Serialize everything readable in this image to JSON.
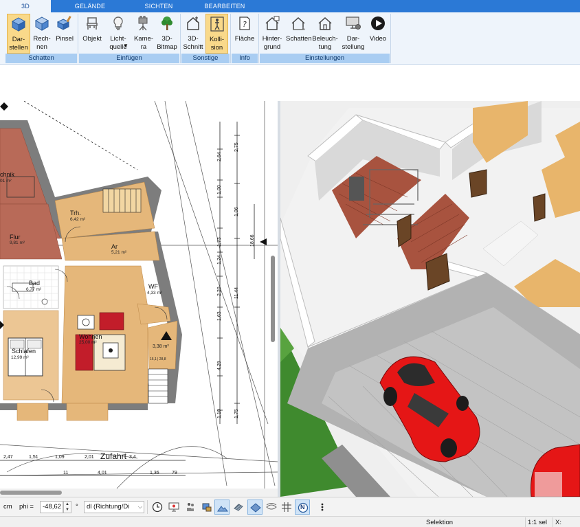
{
  "tabs": [
    {
      "label": "3D",
      "active": true
    },
    {
      "label": "GELÄNDE",
      "active": false
    },
    {
      "label": "SICHTEN",
      "active": false
    },
    {
      "label": "BEARBEITEN",
      "active": false
    }
  ],
  "ribbon": {
    "buttons": {
      "darstellen": "Dar-\nstellen",
      "rechnen": "Rech-\nnen",
      "pinsel": "Pinsel",
      "objekt": "Objekt",
      "lichtquelle": "Licht-\nquelle",
      "kamera": "Kame-\nra",
      "bitmap3d": "3D-\nBitmap",
      "schnitt3d": "3D-\nSchnitt",
      "kollision": "Kolli-\nsion",
      "flaeche": "Fläche",
      "hintergrund": "Hinter-\ngrund",
      "schatten_btn": "Schatten",
      "beleuchtung": "Beleuch-\ntung",
      "darstellung": "Dar-\nstellung",
      "video": "Video"
    },
    "groups": {
      "schatten": "Schatten",
      "einfuegen": "Einfügen",
      "sonstige": "Sonstige",
      "info": "Info",
      "einstellungen": "Einstellungen"
    },
    "accent": "#2b79d6",
    "active_button_color": "#f9d98a"
  },
  "plan": {
    "rooms": {
      "technik": {
        "name": "chnik",
        "area": "01 m²"
      },
      "flur": {
        "name": "Flur",
        "area": "9,81 m²"
      },
      "treppe": {
        "name": "Trh.",
        "area": "6,42 m²"
      },
      "ar": {
        "name": "Ar",
        "area": "5,21 m²"
      },
      "bad": {
        "name": "Bad",
        "area": "6,77 m²"
      },
      "wf": {
        "name": "WF",
        "area": "4,33 m²"
      },
      "wohnen": {
        "name": "Wohnen",
        "area": "25,00 m²"
      },
      "schlafen": {
        "name": "Schlafen",
        "area": "12,99 m²"
      },
      "kleinraum": {
        "name": "",
        "area": "3,38 m²"
      },
      "stair_note": {
        "name": "",
        "area": "16,1 | 28,8"
      }
    },
    "driveway_label": "Zufahrt",
    "dims_bottom_row1": [
      "2,47",
      "1,51",
      "1,09",
      "2,01",
      "3,4"
    ],
    "dims_bottom_row2": [
      "11",
      "4,01",
      "1,36",
      "79"
    ],
    "dims_vertical_left": [
      "2,64",
      "1,00",
      "1,73",
      "1,24",
      "2,20",
      "1,63",
      "4,29",
      "1,10"
    ],
    "dims_vertical_right": [
      "2,75",
      "1,06",
      "11,44",
      "1,75"
    ],
    "dim_total": "18,66"
  },
  "toolbar": {
    "unit": "cm",
    "phi_label": "phi =",
    "phi_value": "-48,62",
    "degree": "°",
    "mode_select": "dl (Richtung/Di",
    "north_letter": "N"
  },
  "status": {
    "mode": "Selektion",
    "scale": "1:1 sel",
    "x_label": "X:"
  }
}
